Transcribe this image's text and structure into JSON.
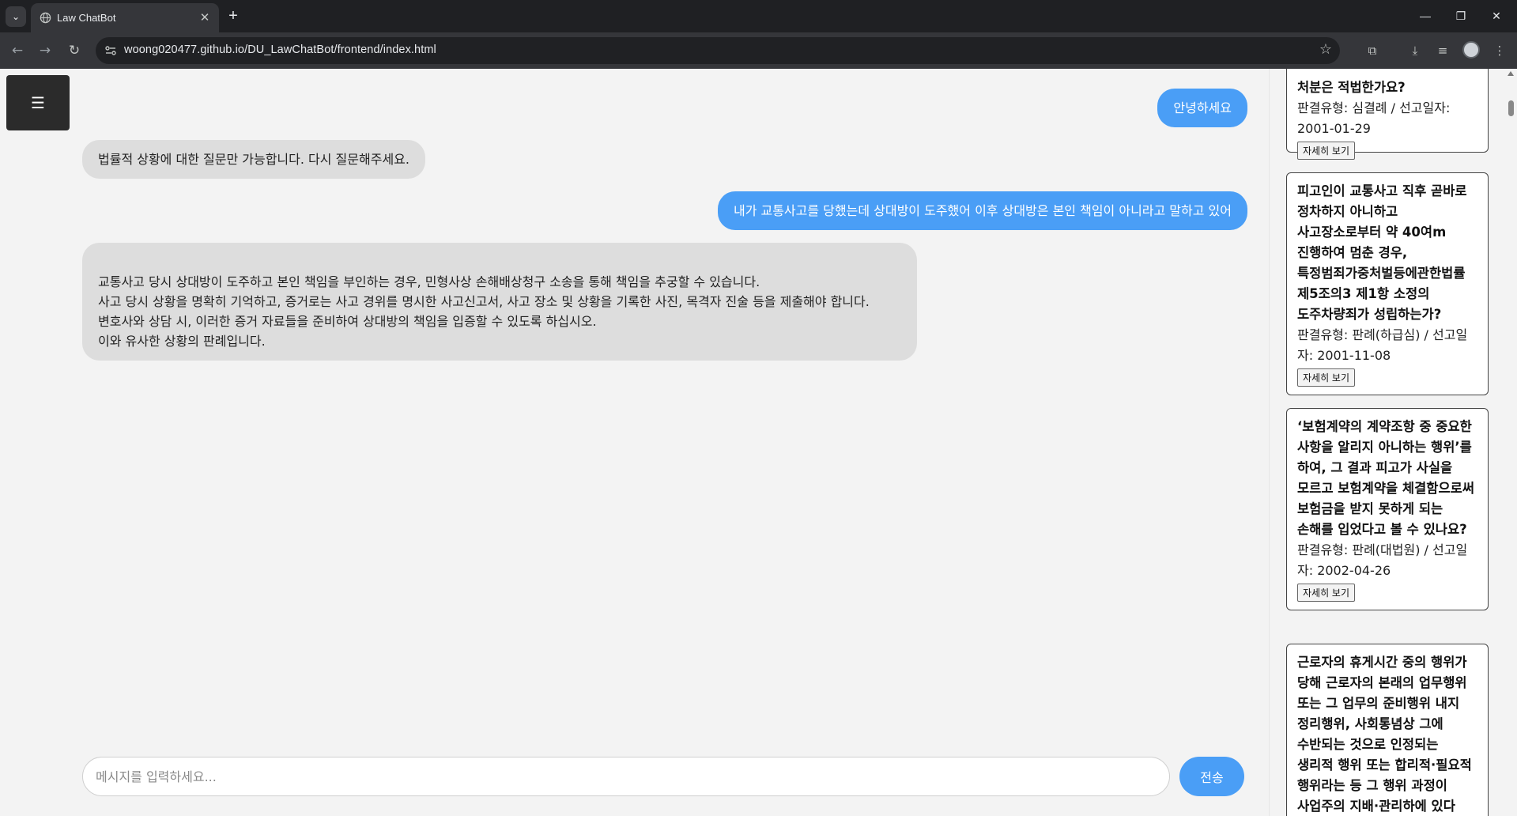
{
  "browser": {
    "tab_title": "Law ChatBot",
    "url": "woong020477.github.io/DU_LawChatBot/frontend/index.html"
  },
  "menu": {
    "icon": "☰"
  },
  "messages": [
    {
      "role": "user",
      "text": "안녕하세요"
    },
    {
      "role": "bot",
      "text": "법률적 상황에 대한 질문만 가능합니다. 다시 질문해주세요."
    },
    {
      "role": "user",
      "text": "내가 교통사고를 당했는데 상대방이 도주했어 이후 상대방은 본인 책임이 아니라고 말하고 있어"
    },
    {
      "role": "bot",
      "text": "교통사고 당시 상대방이 도주하고 본인 책임을 부인하는 경우, 민형사상 손해배상청구 소송을 통해 책임을 추궁할 수 있습니다.\n사고 당시 상황을 명확히 기억하고, 증거로는 사고 경위를 명시한 사고신고서, 사고 장소 및 상황을 기록한 사진, 목격자 진술 등을 제출해야 합니다.\n변호사와 상담 시, 이러한 증거 자료들을 준비하여 상대방의 책임을 입증할 수 있도록 하십시오.\n이와 유사한 상황의 판례입니다."
    }
  ],
  "input": {
    "placeholder": "메시지를 입력하세요...",
    "send_label": "전송"
  },
  "cases": [
    {
      "title": "처분은 적법한가요?",
      "meta": "판결유형: 심결례 / 선고일자: 2001-01-29",
      "button": "자세히 보기"
    },
    {
      "title": "피고인이 교통사고 직후 곧바로 정차하지 아니하고 사고장소로부터 약 40여m 진행하여 멈춘 경우, 특정범죄가중처벌등에관한법률 제5조의3 제1항 소정의 도주차량죄가 성립하는가?",
      "meta": "판결유형: 판례(하급심) / 선고일자: 2001-11-08",
      "button": "자세히 보기"
    },
    {
      "title": "‘보험계약의 계약조항 중 중요한 사항을 알리지 아니하는 행위’를 하여, 그 결과 피고가 사실을 모르고 보험계약을 체결함으로써 보험금을 받지 못하게 되는 손해를 입었다고 볼 수 있나요?",
      "meta": "판결유형: 판례(대법원) / 선고일자: 2002-04-26",
      "button": "자세히 보기"
    },
    {
      "title": "근로자의 휴게시간 중의 행위가 당해 근로자의 본래의 업무행위 또는 그 업무의 준비행위 내지 정리행위, 사회통념상 그에 수반되는 것으로 인정되는 생리적 행위 또는 합리적·필요적 행위라는 등 그 행위 과정이 사업주의 지배·관리하에 있다",
      "meta": "",
      "button": ""
    }
  ]
}
